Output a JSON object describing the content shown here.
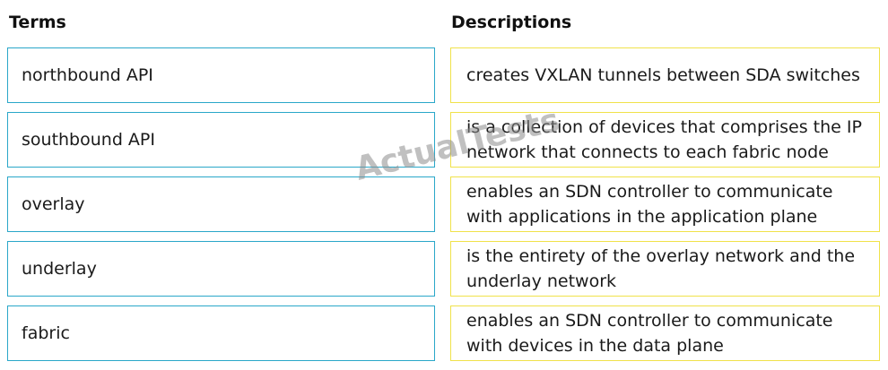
{
  "headers": {
    "terms": "Terms",
    "descriptions": "Descriptions"
  },
  "terms": [
    "northbound API",
    "southbound API",
    "overlay",
    "underlay",
    "fabric"
  ],
  "descriptions": [
    "creates VXLAN tunnels between SDA switches",
    "is a collection of devices that comprises the IP network that connects to each fabric node",
    "enables an SDN controller to communicate with applications in the application plane",
    "is the entirety of the overlay network and the underlay network",
    "enables an SDN controller to communicate with devices in the data plane"
  ],
  "watermark": "ActualTests",
  "colors": {
    "term_border": "#2aa7c9",
    "description_border": "#f0e24a"
  }
}
